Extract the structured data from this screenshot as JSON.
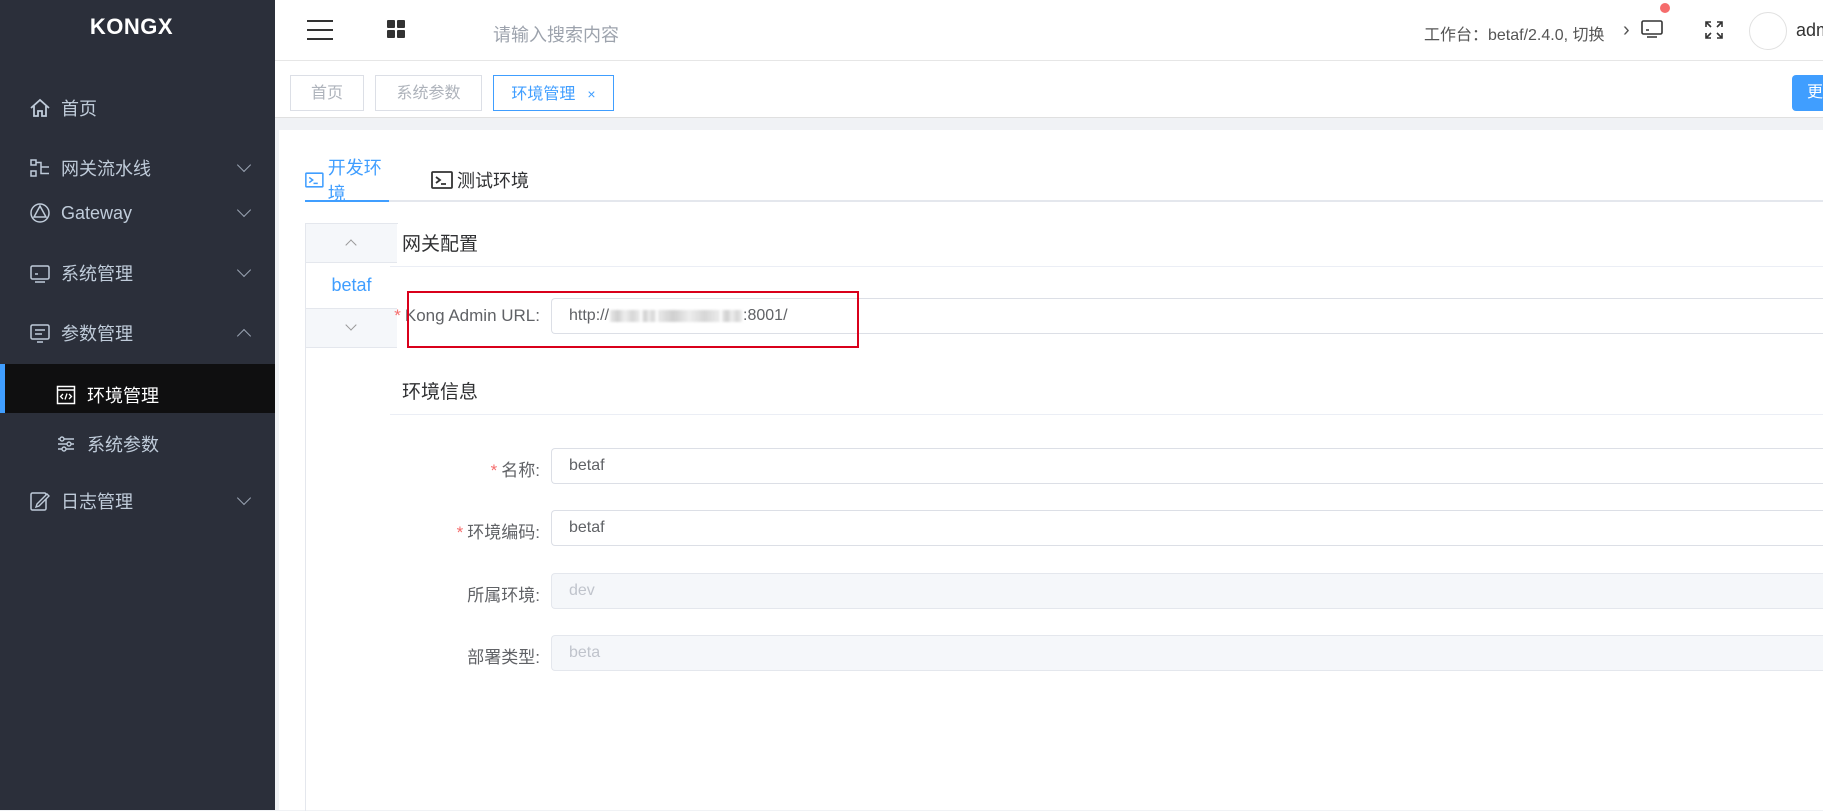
{
  "app": {
    "logo": "KONGX"
  },
  "sidebar": {
    "items": [
      {
        "label": "首页",
        "icon": "home-icon"
      },
      {
        "label": "网关流水线",
        "icon": "pipeline-icon"
      },
      {
        "label": "Gateway",
        "icon": "gateway-icon"
      },
      {
        "label": "系统管理",
        "icon": "monitor-icon"
      },
      {
        "label": "参数管理",
        "icon": "params-icon"
      }
    ],
    "sub_items": [
      {
        "label": "环境管理",
        "icon": "code-window-icon",
        "active": true
      },
      {
        "label": "系统参数",
        "icon": "sliders-icon",
        "active": false
      }
    ],
    "log_item": {
      "label": "日志管理",
      "icon": "edit-log-icon"
    }
  },
  "header": {
    "search_placeholder": "请输入搜索内容",
    "workspace": "工作台：betaf/2.4.0, 切换",
    "user": "adm"
  },
  "tags": {
    "home": "首页",
    "params": "系统参数",
    "env": "环境管理",
    "close": "×",
    "right_button": "更"
  },
  "tabs": {
    "dev": "开发环境",
    "test": "测试环境"
  },
  "env_list": {
    "selected": "betaf"
  },
  "sections": {
    "gateway": "网关配置",
    "env_info": "环境信息"
  },
  "form": {
    "kong_url_label": "Kong Admin URL:",
    "kong_url_prefix": "http://",
    "kong_url_suffix": ":8001/",
    "name_label": "名称:",
    "name_value": "betaf",
    "code_label": "环境编码:",
    "code_value": "betaf",
    "env_label": "所属环境:",
    "env_value": "dev",
    "deploy_label": "部署类型:",
    "deploy_value": "beta"
  },
  "colors": {
    "accent": "#409eff",
    "sidebar_bg": "#2b2f3a",
    "required": "#f56c6c",
    "highlight": "#d9001b"
  }
}
